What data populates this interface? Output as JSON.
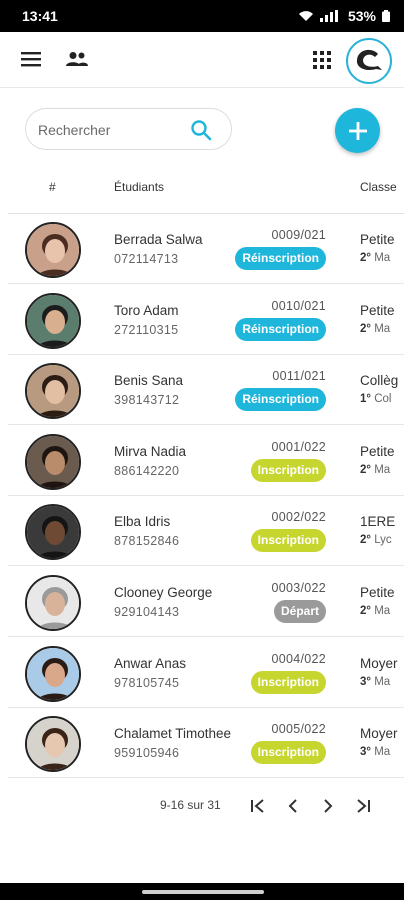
{
  "status_bar": {
    "time": "13:41",
    "battery": "53%"
  },
  "search": {
    "placeholder": "Rechercher"
  },
  "table": {
    "headers": {
      "number": "#",
      "students": "Étudiants",
      "class": "Classe"
    },
    "rows": [
      {
        "name": "Berrada Salwa",
        "phone": "072114713",
        "code": "0009/021",
        "status": "Réinscription",
        "status_color": "#1fb6dc",
        "class_main": "Petite",
        "class_sub_bold": "2°",
        "class_sub": "Ma",
        "avatar_bg": "#c9a08a",
        "avatar_skin": "#e8c4ad",
        "avatar_hair": "#4a2d20"
      },
      {
        "name": "Toro Adam",
        "phone": "272110315",
        "code": "0010/021",
        "status": "Réinscription",
        "status_color": "#1fb6dc",
        "class_main": "Petite",
        "class_sub_bold": "2°",
        "class_sub": "Ma",
        "avatar_bg": "#5b7d6e",
        "avatar_skin": "#d9b08f",
        "avatar_hair": "#1c1c1c"
      },
      {
        "name": "Benis Sana",
        "phone": "398143712",
        "code": "0011/021",
        "status": "Réinscription",
        "status_color": "#1fb6dc",
        "class_main": "Collèg",
        "class_sub_bold": "1°",
        "class_sub": "Col",
        "avatar_bg": "#b89a80",
        "avatar_skin": "#e2bfa2",
        "avatar_hair": "#2b1c14"
      },
      {
        "name": "Mirva Nadia",
        "phone": "886142220",
        "code": "0001/022",
        "status": "Inscription",
        "status_color": "#c6d62e",
        "class_main": "Petite",
        "class_sub_bold": "2°",
        "class_sub": "Ma",
        "avatar_bg": "#6b5a4e",
        "avatar_skin": "#b98d6c",
        "avatar_hair": "#1e1410"
      },
      {
        "name": "Elba Idris",
        "phone": "878152846",
        "code": "0002/022",
        "status": "Inscription",
        "status_color": "#c6d62e",
        "class_main": "1ERE",
        "class_sub_bold": "2°",
        "class_sub": "Lyc",
        "avatar_bg": "#3a3a3a",
        "avatar_skin": "#6e4a34",
        "avatar_hair": "#141414"
      },
      {
        "name": "Clooney George",
        "phone": "929104143",
        "code": "0003/022",
        "status": "Départ",
        "status_color": "#9a9a9a",
        "class_main": "Petite",
        "class_sub_bold": "2°",
        "class_sub": "Ma",
        "avatar_bg": "#e8e8e8",
        "avatar_skin": "#d8b39a",
        "avatar_hair": "#9a9a9a"
      },
      {
        "name": "Anwar Anas",
        "phone": "978105745",
        "code": "0004/022",
        "status": "Inscription",
        "status_color": "#c6d62e",
        "class_main": "Moyer",
        "class_sub_bold": "3°",
        "class_sub": "Ma",
        "avatar_bg": "#a9cbe8",
        "avatar_skin": "#d9a88a",
        "avatar_hair": "#2a1c14"
      },
      {
        "name": "Chalamet Timothee",
        "phone": "959105946",
        "code": "0005/022",
        "status": "Inscription",
        "status_color": "#c6d62e",
        "class_main": "Moyer",
        "class_sub_bold": "3°",
        "class_sub": "Ma",
        "avatar_bg": "#d6d2cc",
        "avatar_skin": "#e6c7b0",
        "avatar_hair": "#3a2418"
      }
    ]
  },
  "pagination": {
    "range": "9-16 sur 31"
  },
  "colors": {
    "accent": "#1fb6dc",
    "inscription": "#c6d62e",
    "depart": "#9a9a9a"
  }
}
